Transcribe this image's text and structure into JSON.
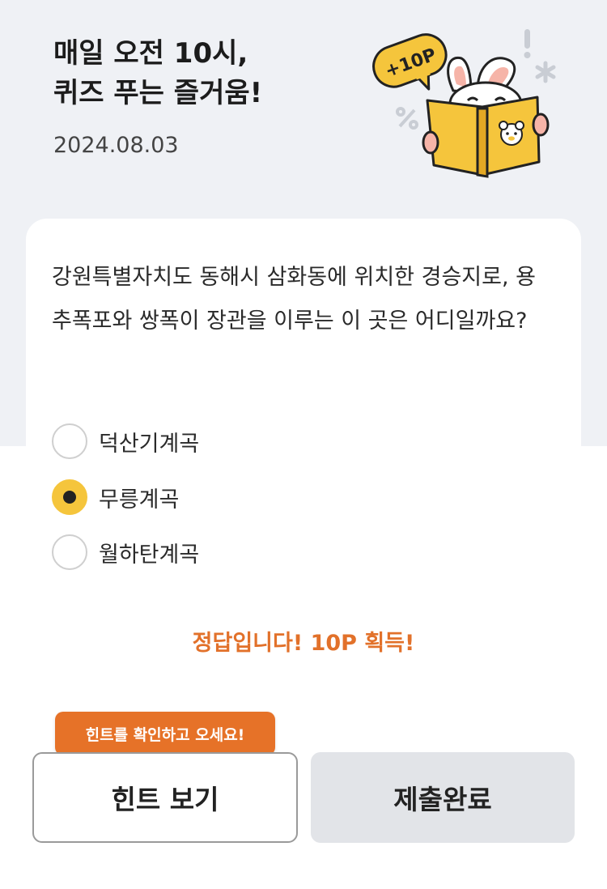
{
  "header": {
    "title_line1": "매일 오전 10시,",
    "title_line2": "퀴즈 푸는 즐거움!",
    "date": "2024.08.03"
  },
  "illustration": {
    "badge": "+10P",
    "icons": [
      "speech-bubble-badge",
      "rabbit-reading-book",
      "exclamation",
      "asterisk",
      "percent"
    ]
  },
  "quiz": {
    "question": "강원특별자치도 동해시 삼화동에 위치한 경승지로, 용추폭포와 쌍폭이 장관을 이루는 이 곳은 어디일까요?",
    "options": [
      {
        "label": "덕산기계곡",
        "selected": false
      },
      {
        "label": "무릉계곡",
        "selected": true
      },
      {
        "label": "월하탄계곡",
        "selected": false
      }
    ],
    "result": "정답입니다! 10P 획득!"
  },
  "actions": {
    "tooltip": "힌트를 확인하고 오세요!",
    "hint_button": "힌트 보기",
    "submit_button": "제출완료"
  },
  "colors": {
    "background": "#eff1f5",
    "accent_yellow": "#f5c53c",
    "accent_orange": "#e67228",
    "result_orange": "#e2712a",
    "disabled_button": "#e2e4e8"
  }
}
